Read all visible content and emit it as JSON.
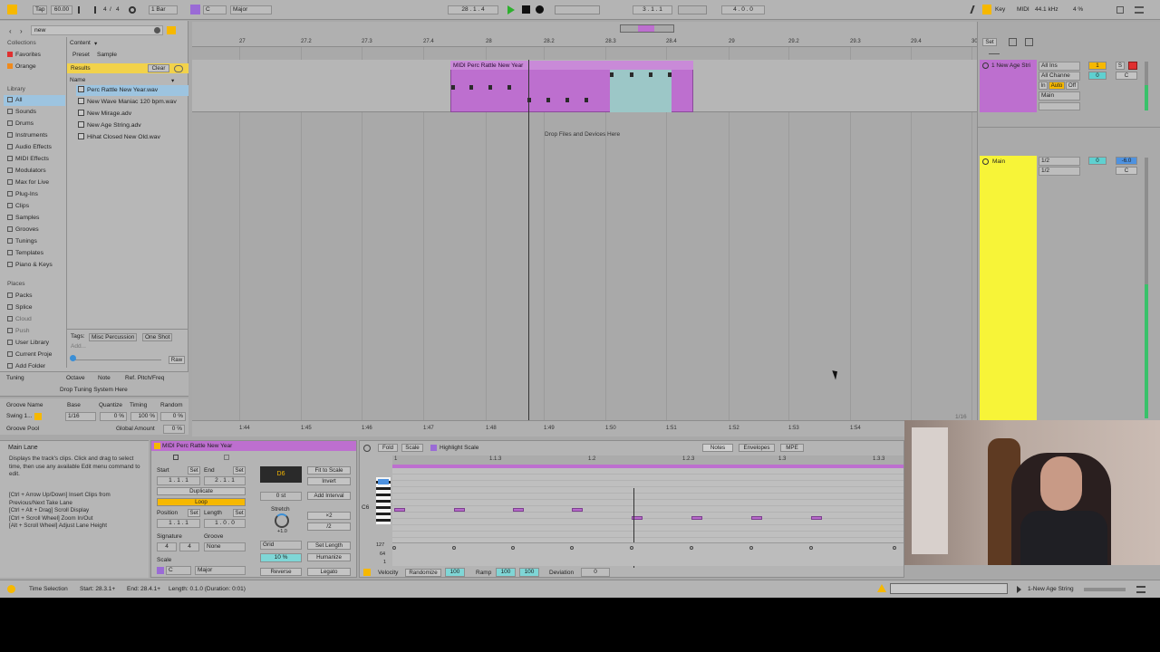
{
  "transport": {
    "tap": "Tap",
    "tempo": "60.00",
    "signature_num": "4",
    "signature_den": "4",
    "quantize": "1 Bar",
    "key": "C",
    "scale": "Major",
    "position": "28 . 1 . 4",
    "loop_start": "3 . 1 . 1",
    "loop_length": "4 . 0 . 0",
    "key_label": "Key",
    "midi_label": "MIDI",
    "sample_rate": "44.1 kHz",
    "cpu": "4 %"
  },
  "browser": {
    "search_value": "new",
    "collections_header": "Collections",
    "collections": [
      "Favorites",
      "Orange"
    ],
    "library_header": "Library",
    "library": [
      "All",
      "Sounds",
      "Drums",
      "Instruments",
      "Audio Effects",
      "MIDI Effects",
      "Modulators",
      "Max for Live",
      "Plug-Ins",
      "Clips",
      "Samples",
      "Grooves",
      "Tunings",
      "Templates",
      "Piano & Keys"
    ],
    "places_header": "Places",
    "places": [
      "Packs",
      "Splice",
      "Cloud",
      "Push",
      "User Library",
      "Current Proje",
      "Add Folder"
    ],
    "content_label": "Content",
    "filter_preset": "Preset",
    "filter_sample": "Sample",
    "results_label": "Results",
    "clear_label": "Clear",
    "name_header": "Name",
    "files": [
      "Perc Rattle New Year.wav",
      "New Wave Maniac 120 bpm.wav",
      "New Mirage.adv",
      "New Age String.adv",
      "Hihat Closed New Old.wav"
    ],
    "tags_label": "Tags:",
    "tags": [
      "Misc Percussion",
      "One Shot"
    ],
    "add_label": "Add...",
    "raw_label": "Raw"
  },
  "tuning": {
    "title": "Tuning",
    "octave": "Octave",
    "note": "Note",
    "ref": "Ref. Pitch/Freq",
    "drop_text": "Drop Tuning System Here"
  },
  "groove_pool": {
    "cols": [
      "Groove Name",
      "Base",
      "Quantize",
      "Timing",
      "Random"
    ],
    "row_name": "Swing 1...",
    "row_base": "1/16",
    "row_quantize": "0 %",
    "row_timing": "100 %",
    "row_random": "0 %",
    "footer": "Groove Pool",
    "global_amount_label": "Global Amount",
    "global_amount": "0 %"
  },
  "arrangement": {
    "ruler_bars": [
      "27",
      "27.2",
      "27.3",
      "27.4",
      "28",
      "28.2",
      "28.3",
      "28.4",
      "29",
      "29.2",
      "29.3",
      "29.4",
      "30"
    ],
    "clip_name": "MIDI Perc Rattle New Year",
    "drop_text": "Drop Files and Devices Here",
    "time_labels": [
      "1:44",
      "1:45",
      "1:46",
      "1:47",
      "1:48",
      "1:49",
      "1:50",
      "1:51",
      "1:52",
      "1:53",
      "1:54"
    ],
    "set_label": "Set",
    "zoom_label": "1/16"
  },
  "tracks": {
    "track1_name": "1 New Age Stri",
    "track1_input": "All Ins",
    "track1_channel": "All Channe",
    "track1_monitor_in": "In",
    "track1_monitor_auto": "Auto",
    "track1_monitor_off": "Off",
    "track1_output": "Main",
    "track1_number": "1",
    "track1_solo": "S",
    "track1_pan": "C",
    "track1_vol": "0",
    "main_name": "Main",
    "main_in1": "1/2",
    "main_in2": "1/2",
    "main_vol": "0",
    "main_db": "-6.0",
    "main_pan": "C"
  },
  "info": {
    "title": "Main Lane",
    "description": "Displays the track's clips. Click and drag to select time, then use any available Edit menu command to edit.",
    "shortcuts": "[Ctrl + Arrow Up/Down] Insert Clips from Previous/Next Take Lane\n[Ctrl + Alt + Drag] Scroll Display\n[Ctrl + Scroll Wheel] Zoom In/Out\n[Alt + Scroll Wheel] Adjust Lane Height"
  },
  "clip_view": {
    "clip_title": "MIDI Perc Rattle New Year",
    "start_label": "Start",
    "end_label": "End",
    "set_label": "Set",
    "start_value": "1 . 1 . 1",
    "end_value": "2 . 1 . 1",
    "duplicate": "Duplicate",
    "loop": "Loop",
    "position_label": "Position",
    "length_label": "Length",
    "position_value": "1 . 1 . 1",
    "length_value": "1 . 0 . 0",
    "signature_label": "Signature",
    "groove_label": "Groove",
    "sig_num": "4",
    "sig_den": "4",
    "groove_value": "None",
    "scale_label": "Scale",
    "scale_key": "C",
    "scale_mode": "Major",
    "note_name": "D6",
    "fit_to_scale": "Fit to Scale",
    "invert": "Invert",
    "add_interval": "Add Interval",
    "st_value": "0 st",
    "stretch_label": "Stretch",
    "times2": "×2",
    "div2": "/2",
    "grid_label": "Grid",
    "set_length": "Set Length",
    "humanize": "Humanize",
    "humanize_value": "10 %",
    "reverse": "Reverse",
    "legato": "Legato",
    "stretch_value": "+1.0"
  },
  "piano_roll": {
    "fold": "Fold",
    "scale": "Scale",
    "highlight_scale": "Highlight Scale",
    "notes_tab": "Notes",
    "envelopes_tab": "Envelopes",
    "mpe_tab": "MPE",
    "ruler": [
      "1",
      "1.1.3",
      "1.2",
      "1.2.3",
      "1.3",
      "1.3.3"
    ],
    "c6_label": "C6",
    "vel_labels": [
      "127",
      "64",
      "1"
    ],
    "velocity_label": "Velocity",
    "randomize": "Randomize",
    "vel_value": "100",
    "ramp_label": "Ramp",
    "ramp_a": "100",
    "ramp_b": "100",
    "deviation_label": "Deviation",
    "deviation_value": "0"
  },
  "status": {
    "selection": "Time Selection",
    "start": "Start: 28.3.1+",
    "end": "End: 28.4.1+",
    "length": "Length: 0.1.0 (Duration: 0:01)",
    "track_name": "1-New Age String"
  },
  "colors": {
    "clip_purple": "#bd6fcf",
    "main_yellow": "#f7f438",
    "loop_teal": "#9cc7c7",
    "accent_orange": "#f6b800"
  }
}
